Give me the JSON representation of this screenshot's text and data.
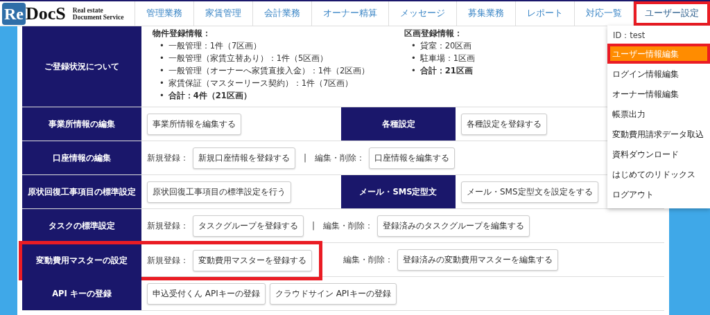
{
  "logo": {
    "mark": "Re",
    "name": "DocS",
    "tagline": [
      "Real estate",
      "Document Service"
    ]
  },
  "nav": [
    {
      "label": "管理業務",
      "selected": false,
      "highlighted": false
    },
    {
      "label": "家賃管理",
      "selected": false,
      "highlighted": false
    },
    {
      "label": "会計業務",
      "selected": false,
      "highlighted": false
    },
    {
      "label": "オーナー精算",
      "selected": false,
      "highlighted": false
    },
    {
      "label": "メッセージ",
      "selected": false,
      "highlighted": false
    },
    {
      "label": "募集業務",
      "selected": false,
      "highlighted": false
    },
    {
      "label": "レポート",
      "selected": false,
      "highlighted": false
    },
    {
      "label": "対応一覧",
      "selected": false,
      "highlighted": false
    },
    {
      "label": "ユーザー設定",
      "selected": true,
      "highlighted": true
    }
  ],
  "dropdown": {
    "id_label": "ID：test",
    "items": [
      {
        "label": "ユーザー情報編集",
        "selected": true,
        "highlighted": true
      },
      {
        "label": "ログイン情報編集",
        "selected": false,
        "highlighted": false
      },
      {
        "label": "オーナー情報編集",
        "selected": false,
        "highlighted": false
      },
      {
        "label": "帳票出力",
        "selected": false,
        "highlighted": false
      },
      {
        "label": "変動費用請求データ取込",
        "selected": false,
        "highlighted": false
      },
      {
        "label": "資料ダウンロード",
        "selected": false,
        "highlighted": false
      },
      {
        "label": "はじめてのリドックス",
        "selected": false,
        "highlighted": false
      },
      {
        "label": "ログアウト",
        "selected": false,
        "highlighted": false
      }
    ]
  },
  "status": {
    "label": "ご登録状況について",
    "groups": [
      {
        "heading": "物件登録情報：",
        "marker": "•",
        "items": [
          {
            "text": "一般管理：1件（7区画）",
            "bold": false
          },
          {
            "text": "一般管理（家賃立替あり）：1件（5区画）",
            "bold": false
          },
          {
            "text": "一般管理（オーナーへ家賃直接入金）：1件（2区画）",
            "bold": false
          },
          {
            "text": "家賃保証（マスターリース契約）：1件（7区画）",
            "bold": false
          },
          {
            "text": "合計：4件（21区画）",
            "bold": true
          }
        ]
      },
      {
        "heading": "区画登録情報：",
        "marker": "•",
        "items": [
          {
            "text": "貸室：20区画",
            "bold": false
          },
          {
            "text": "駐車場：1区画",
            "bold": false
          },
          {
            "text": "合計：21区画",
            "bold": true
          }
        ]
      }
    ]
  },
  "rows": [
    {
      "highlighted": false,
      "sections": [
        {
          "label": "事業所情報の編集",
          "parts": [
            {
              "kind": "button",
              "text": "事業所情報を編集する"
            }
          ]
        },
        {
          "label": "各種設定",
          "parts": [
            {
              "kind": "button",
              "text": "各種設定を登録する"
            }
          ]
        }
      ]
    },
    {
      "highlighted": false,
      "sections": [
        {
          "label": "口座情報の編集",
          "parts": [
            {
              "kind": "text",
              "text": "新規登録："
            },
            {
              "kind": "button",
              "text": "新規口座情報を登録する"
            },
            {
              "kind": "separator",
              "text": "|"
            },
            {
              "kind": "text",
              "text": "編集・削除："
            },
            {
              "kind": "button",
              "text": "口座情報を編集する"
            }
          ]
        }
      ]
    },
    {
      "highlighted": false,
      "sections": [
        {
          "label": "原状回復工事項目の標準設定",
          "parts": [
            {
              "kind": "button",
              "text": "原状回復工事項目の標準設定を行う"
            }
          ]
        },
        {
          "label": "メール・SMS定型文",
          "parts": [
            {
              "kind": "button",
              "text": "メール・SMS定型文を設定をする"
            }
          ]
        }
      ]
    },
    {
      "highlighted": false,
      "sections": [
        {
          "label": "タスクの標準設定",
          "parts": [
            {
              "kind": "text",
              "text": "新規登録："
            },
            {
              "kind": "button",
              "text": "タスクグループを登録する"
            },
            {
              "kind": "separator",
              "text": "|"
            },
            {
              "kind": "text",
              "text": "編集・削除："
            },
            {
              "kind": "button",
              "text": "登録済みのタスクグループを編集する"
            }
          ]
        }
      ]
    },
    {
      "highlighted": true,
      "sections": [
        {
          "label": "変動費用マスターの設定",
          "parts": [
            {
              "kind": "text",
              "text": "新規登録："
            },
            {
              "kind": "button",
              "text": "変動費用マスターを登録する"
            },
            {
              "kind": "gap"
            },
            {
              "kind": "text",
              "text": "編集・削除："
            },
            {
              "kind": "button",
              "text": "登録済みの変動費用マスターを編集する"
            }
          ]
        }
      ]
    },
    {
      "highlighted": false,
      "sections": [
        {
          "label": "API キーの登録",
          "parts": [
            {
              "kind": "button",
              "text": "申込受付くん APIキーの登録"
            },
            {
              "kind": "button",
              "text": "クラウドサイン APIキーの登録"
            }
          ]
        }
      ]
    }
  ]
}
